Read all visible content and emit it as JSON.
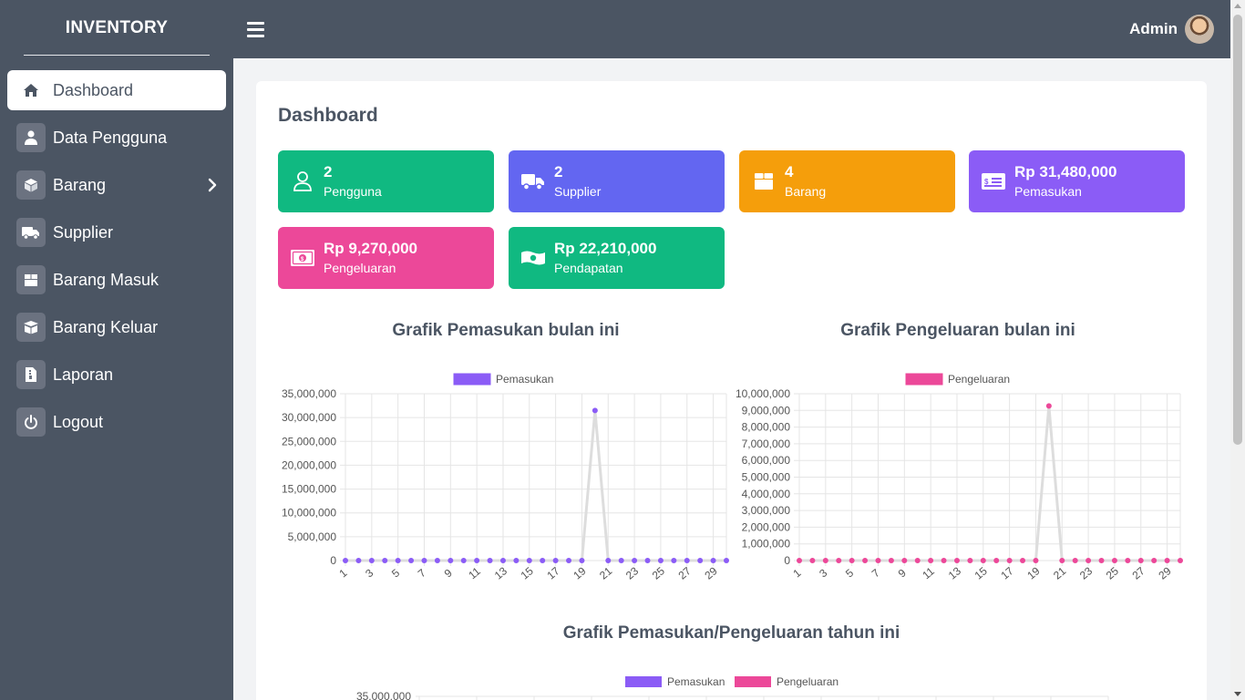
{
  "sidebar": {
    "brand": "INVENTORY",
    "items": [
      {
        "label": "Dashboard",
        "icon": "home-icon",
        "active": true
      },
      {
        "label": "Data Pengguna",
        "icon": "user-icon"
      },
      {
        "label": "Barang",
        "icon": "box-icon",
        "has_submenu": true
      },
      {
        "label": "Supplier",
        "icon": "truck-icon"
      },
      {
        "label": "Barang Masuk",
        "icon": "box-in-icon"
      },
      {
        "label": "Barang Keluar",
        "icon": "box-out-icon"
      },
      {
        "label": "Laporan",
        "icon": "file-icon"
      },
      {
        "label": "Logout",
        "icon": "power-icon"
      }
    ]
  },
  "topbar": {
    "user_name": "Admin"
  },
  "page": {
    "title": "Dashboard"
  },
  "stats": [
    {
      "value": "2",
      "label": "Pengguna",
      "color": "#10b981",
      "icon": "user-outline-icon"
    },
    {
      "value": "2",
      "label": "Supplier",
      "color": "#6366f1",
      "icon": "truck-icon"
    },
    {
      "value": "4",
      "label": "Barang",
      "color": "#f59e0b",
      "icon": "box-icon"
    },
    {
      "value": "Rp 31,480,000",
      "label": "Pemasukan",
      "color": "#8b5cf6",
      "icon": "money-check-icon"
    },
    {
      "value": "Rp 9,270,000",
      "label": "Pengeluaran",
      "color": "#ec4899",
      "icon": "money-bill-icon"
    },
    {
      "value": "Rp 22,210,000",
      "label": "Pendapatan",
      "color": "#10b981",
      "icon": "money-bill-wave-icon"
    }
  ],
  "charts": {
    "income_title": "Grafik Pemasukan bulan ini",
    "expense_title": "Grafik Pengeluaran bulan ini",
    "yearly_title": "Grafik Pemasukan/Pengeluaran tahun ini"
  },
  "chart_data": [
    {
      "type": "line",
      "title": "Grafik Pemasukan bulan ini",
      "legend": "top",
      "grid": true,
      "x": [
        1,
        2,
        3,
        4,
        5,
        6,
        7,
        8,
        9,
        10,
        11,
        12,
        13,
        14,
        15,
        16,
        17,
        18,
        19,
        20,
        21,
        22,
        23,
        24,
        25,
        26,
        27,
        28,
        29,
        30
      ],
      "x_tick_labels": [
        "1",
        "3",
        "5",
        "7",
        "9",
        "11",
        "13",
        "15",
        "17",
        "19",
        "21",
        "23",
        "25",
        "27",
        "29"
      ],
      "series": [
        {
          "name": "Pemasukan",
          "color": "#8b5cf6",
          "values": [
            0,
            0,
            0,
            0,
            0,
            0,
            0,
            0,
            0,
            0,
            0,
            0,
            0,
            0,
            0,
            0,
            0,
            0,
            0,
            31480000,
            0,
            0,
            0,
            0,
            0,
            0,
            0,
            0,
            0,
            0
          ]
        }
      ],
      "ylim": [
        0,
        35000000
      ],
      "y_ticks": [
        "0",
        "5,000,000",
        "10,000,000",
        "15,000,000",
        "20,000,000",
        "25,000,000",
        "30,000,000",
        "35,000,000"
      ],
      "y_tick_values": [
        0,
        5000000,
        10000000,
        15000000,
        20000000,
        25000000,
        30000000,
        35000000
      ]
    },
    {
      "type": "line",
      "title": "Grafik Pengeluaran bulan ini",
      "legend": "top",
      "grid": true,
      "x": [
        1,
        2,
        3,
        4,
        5,
        6,
        7,
        8,
        9,
        10,
        11,
        12,
        13,
        14,
        15,
        16,
        17,
        18,
        19,
        20,
        21,
        22,
        23,
        24,
        25,
        26,
        27,
        28,
        29,
        30
      ],
      "x_tick_labels": [
        "1",
        "3",
        "5",
        "7",
        "9",
        "11",
        "13",
        "15",
        "17",
        "19",
        "21",
        "23",
        "25",
        "27",
        "29"
      ],
      "series": [
        {
          "name": "Pengeluaran",
          "color": "#ec4899",
          "values": [
            0,
            0,
            0,
            0,
            0,
            0,
            0,
            0,
            0,
            0,
            0,
            0,
            0,
            0,
            0,
            0,
            0,
            0,
            0,
            9270000,
            0,
            0,
            0,
            0,
            0,
            0,
            0,
            0,
            0,
            0
          ]
        }
      ],
      "ylim": [
        0,
        10000000
      ],
      "y_ticks": [
        "0",
        "1,000,000",
        "2,000,000",
        "3,000,000",
        "4,000,000",
        "5,000,000",
        "6,000,000",
        "7,000,000",
        "8,000,000",
        "9,000,000",
        "10,000,000"
      ],
      "y_tick_values": [
        0,
        1000000,
        2000000,
        3000000,
        4000000,
        5000000,
        6000000,
        7000000,
        8000000,
        9000000,
        10000000
      ]
    },
    {
      "type": "bar",
      "title": "Grafik Pemasukan/Pengeluaran tahun ini",
      "legend": "top",
      "grid": true,
      "series": [
        {
          "name": "Pemasukan",
          "color": "#8b5cf6"
        },
        {
          "name": "Pengeluaran",
          "color": "#ec4899"
        }
      ],
      "y_ticks_visible": [
        "35,000,000"
      ]
    }
  ]
}
